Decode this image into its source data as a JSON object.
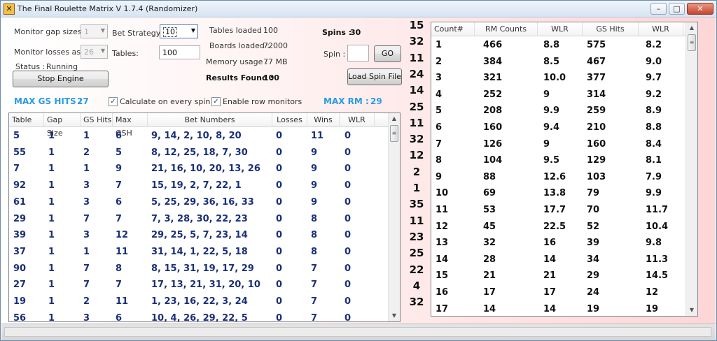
{
  "window": {
    "title": "The Final Roulette Matrix V 1.7.4 (Randomizer)",
    "min_glyph": "–",
    "max_glyph": "□",
    "close_glyph": "✕"
  },
  "controls": {
    "monitor_gap_label": "Monitor gap sizes :",
    "monitor_gap_value": "1",
    "monitor_losses_label": "Monitor losses as :",
    "monitor_losses_value": "26",
    "status_label": "Status :",
    "status_value": "Running",
    "stop_engine": "Stop Engine",
    "bet_strategy_label": "Bet Strategy :",
    "bet_strategy_value": "10",
    "tables_label": "Tables:",
    "tables_value": "100",
    "tables_loaded_label": "Tables loaded :",
    "tables_loaded_value": "100",
    "boards_loaded_label": "Boards loaded :",
    "boards_loaded_value": "72000",
    "memory_label": "Memory usage :",
    "memory_value": "77 MB",
    "results_label": "Results Found :",
    "results_value": "100",
    "spins_label": "Spins :",
    "spins_value": "30",
    "spin_label": "Spin :",
    "spin_input": "",
    "go": "GO",
    "load_spin_file": "Load Spin File",
    "max_gs_label": "MAX GS HITS :",
    "max_gs_value": "27",
    "calc_every_spin": "Calculate on every spin",
    "enable_row_monitors": "Enable row monitors",
    "max_rm_label": "MAX RM :",
    "max_rm_value": "29",
    "check_glyph": "✓"
  },
  "left_grid": {
    "headers": [
      "Table",
      "Gap Size",
      "GS Hits",
      "Max GSH",
      "Bet Numbers",
      "Losses",
      "Wins",
      "WLR"
    ],
    "rows": [
      [
        "5",
        "1",
        "1",
        "6",
        "9, 14, 2, 10, 8, 20",
        "0",
        "11",
        "0"
      ],
      [
        "55",
        "1",
        "2",
        "5",
        "8, 12, 25, 18, 7, 30",
        "0",
        "9",
        "0"
      ],
      [
        "7",
        "1",
        "1",
        "9",
        "21, 16, 10, 20, 13, 26",
        "0",
        "9",
        "0"
      ],
      [
        "92",
        "1",
        "3",
        "7",
        "15, 19, 2, 7, 22, 1",
        "0",
        "9",
        "0"
      ],
      [
        "61",
        "1",
        "3",
        "6",
        "5, 25, 29, 36, 16, 33",
        "0",
        "9",
        "0"
      ],
      [
        "29",
        "1",
        "7",
        "7",
        "7, 3, 28, 30, 22, 23",
        "0",
        "8",
        "0"
      ],
      [
        "39",
        "1",
        "3",
        "12",
        "29, 25, 5, 7, 23, 14",
        "0",
        "8",
        "0"
      ],
      [
        "37",
        "1",
        "1",
        "11",
        "31, 14, 1, 22, 5, 18",
        "0",
        "8",
        "0"
      ],
      [
        "90",
        "1",
        "7",
        "8",
        "8, 15, 31, 19, 17, 29",
        "0",
        "7",
        "0"
      ],
      [
        "27",
        "1",
        "7",
        "7",
        "17, 13, 21, 31, 20, 10",
        "0",
        "7",
        "0"
      ],
      [
        "19",
        "1",
        "2",
        "11",
        "1, 23, 16, 22, 3, 24",
        "0",
        "7",
        "0"
      ],
      [
        "56",
        "1",
        "3",
        "6",
        "10, 4, 26, 29, 22, 5",
        "0",
        "7",
        "0"
      ]
    ]
  },
  "spin_numbers": [
    "15",
    "32",
    "11",
    "24",
    "14",
    "25",
    "11",
    "32",
    "12",
    "2",
    "1",
    "35",
    "11",
    "23",
    "25",
    "22",
    "4",
    "32"
  ],
  "right_grid": {
    "headers": [
      "Count#",
      "RM Counts",
      "WLR",
      "GS Hits",
      "WLR"
    ],
    "rows": [
      [
        "1",
        "466",
        "8.8",
        "575",
        "8.2"
      ],
      [
        "2",
        "384",
        "8.5",
        "467",
        "9.0"
      ],
      [
        "3",
        "321",
        "10.0",
        "377",
        "9.7"
      ],
      [
        "4",
        "252",
        "9",
        "314",
        "9.2"
      ],
      [
        "5",
        "208",
        "9.9",
        "259",
        "8.9"
      ],
      [
        "6",
        "160",
        "9.4",
        "210",
        "8.8"
      ],
      [
        "7",
        "126",
        "9",
        "160",
        "8.4"
      ],
      [
        "8",
        "104",
        "9.5",
        "129",
        "8.1"
      ],
      [
        "9",
        "88",
        "12.6",
        "103",
        "7.9"
      ],
      [
        "10",
        "69",
        "13.8",
        "79",
        "9.9"
      ],
      [
        "11",
        "53",
        "17.7",
        "70",
        "11.7"
      ],
      [
        "12",
        "45",
        "22.5",
        "52",
        "10.4"
      ],
      [
        "13",
        "32",
        "16",
        "39",
        "9.8"
      ],
      [
        "14",
        "28",
        "14",
        "34",
        "11.3"
      ],
      [
        "15",
        "21",
        "21",
        "29",
        "14.5"
      ],
      [
        "16",
        "17",
        "17",
        "24",
        "12"
      ],
      [
        "17",
        "14",
        "14",
        "19",
        "19"
      ]
    ]
  },
  "icons": {
    "scroll_up": "▲",
    "scroll_down": "▼",
    "thumb_grip": "≡",
    "dropdown_arrow": "▼",
    "app_icon": "✕"
  }
}
